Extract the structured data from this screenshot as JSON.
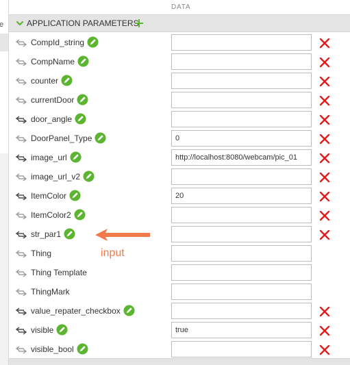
{
  "left_strip": {
    "fragment": "e"
  },
  "header": {
    "data_column": "DATA"
  },
  "section": {
    "title": "APPLICATION PARAMETERS"
  },
  "colors": {
    "accent_green": "#5cb531",
    "delete_red": "#e01b1b",
    "annotation_orange": "#f07a4a"
  },
  "icons": {
    "binding": "binding-arrows-icon",
    "edit": "pencil-icon",
    "delete": "delete-x-icon",
    "add": "plus-icon",
    "collapse": "chevron-down-icon"
  },
  "rows": [
    {
      "name": "CompId_string",
      "value": "",
      "editable": true,
      "deletable": true,
      "bound": false
    },
    {
      "name": "CompName",
      "value": "",
      "editable": true,
      "deletable": true,
      "bound": false
    },
    {
      "name": "counter",
      "value": "",
      "editable": true,
      "deletable": true,
      "bound": false
    },
    {
      "name": "currentDoor",
      "value": "",
      "editable": true,
      "deletable": true,
      "bound": false
    },
    {
      "name": "door_angle",
      "value": "",
      "editable": true,
      "deletable": true,
      "bound": true
    },
    {
      "name": "DoorPanel_Type",
      "value": "0",
      "editable": true,
      "deletable": true,
      "bound": false
    },
    {
      "name": "image_url",
      "value": "http://localhost:8080/webcam/pic_01",
      "editable": true,
      "deletable": true,
      "bound": true
    },
    {
      "name": "image_url_v2",
      "value": "",
      "editable": true,
      "deletable": true,
      "bound": false
    },
    {
      "name": "ItemColor",
      "value": "20",
      "editable": true,
      "deletable": true,
      "bound": true
    },
    {
      "name": "ItemColor2",
      "value": "",
      "editable": true,
      "deletable": true,
      "bound": false
    },
    {
      "name": "str_par1",
      "value": "",
      "editable": true,
      "deletable": true,
      "bound": true
    },
    {
      "name": "Thing",
      "value": "",
      "editable": false,
      "deletable": false,
      "bound": false
    },
    {
      "name": "Thing Template",
      "value": "",
      "editable": false,
      "deletable": false,
      "bound": false
    },
    {
      "name": "ThingMark",
      "value": "",
      "editable": false,
      "deletable": false,
      "bound": false
    },
    {
      "name": "value_repater_checkbox",
      "value": "",
      "editable": true,
      "deletable": true,
      "bound": true
    },
    {
      "name": "visible",
      "value": "true",
      "editable": true,
      "deletable": true,
      "bound": true
    },
    {
      "name": "visible_bool",
      "value": "",
      "editable": true,
      "deletable": true,
      "bound": false
    }
  ],
  "annotation": {
    "text": "input"
  }
}
